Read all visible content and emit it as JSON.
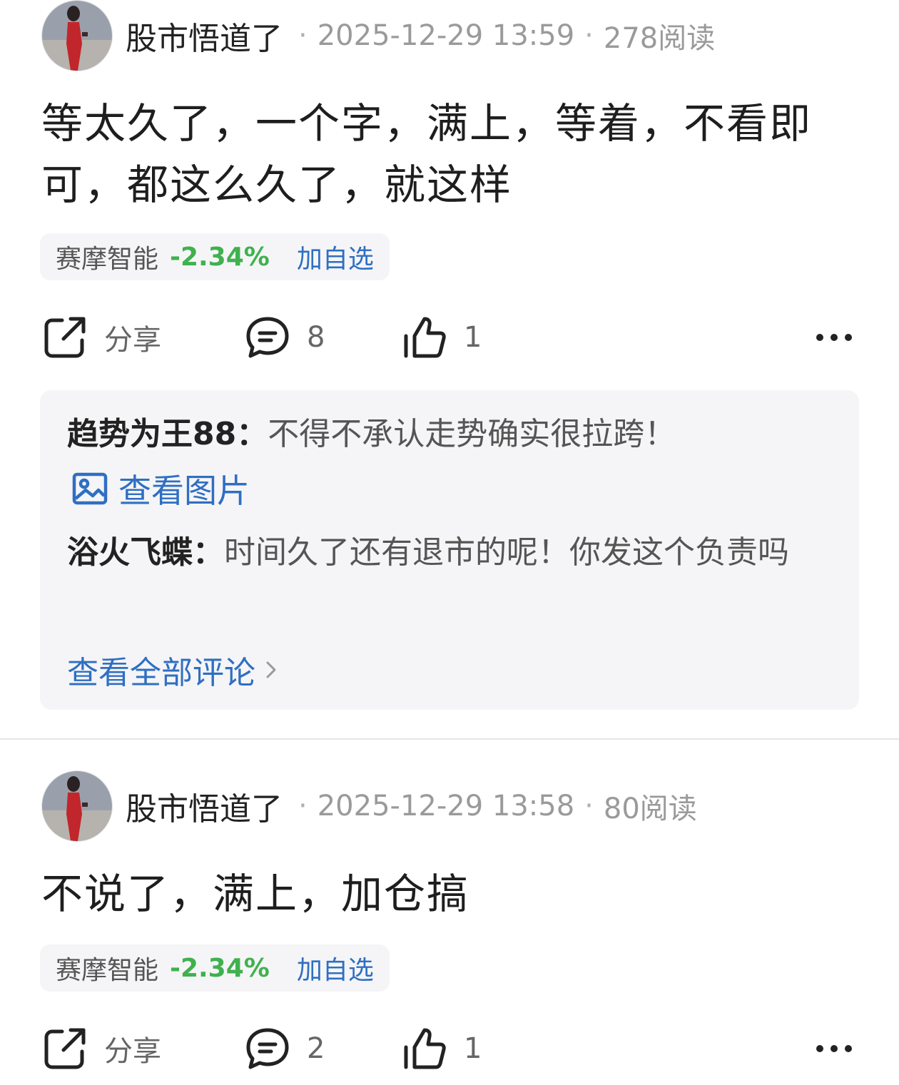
{
  "posts": [
    {
      "author": "股市悟道了",
      "datetime": "2025-12-29 13:59",
      "reads": "278阅读",
      "content": "等太久了，一个字，满上，等着，不看即可，都这么久了，就这样",
      "stock": {
        "name": "赛摩智能",
        "change": "-2.34%",
        "add_label": "加自选"
      },
      "actions": {
        "share_label": "分享",
        "comments": "8",
        "likes": "1"
      },
      "comments_preview": [
        {
          "name": "趋势为王88：",
          "text": "不得不承认走势确实很拉跨！"
        },
        {
          "name": "浴火飞蝶：",
          "text": "时间久了还有退市的呢！你发这个负责吗"
        }
      ],
      "view_image_label": "查看图片",
      "view_all_label": "查看全部评论"
    },
    {
      "author": "股市悟道了",
      "datetime": "2025-12-29 13:58",
      "reads": "80阅读",
      "content": "不说了，满上，加仓搞",
      "stock": {
        "name": "赛摩智能",
        "change": "-2.34%",
        "add_label": "加自选"
      },
      "actions": {
        "share_label": "分享",
        "comments": "2",
        "likes": "1"
      }
    }
  ],
  "colors": {
    "link": "#2f6fc2",
    "down": "#3fb14e",
    "muted": "#9a9a9a",
    "panel": "#f5f5f7"
  },
  "icons": [
    "share-icon",
    "comment-icon",
    "like-icon",
    "more-icon",
    "image-icon",
    "chevron-right-icon"
  ]
}
